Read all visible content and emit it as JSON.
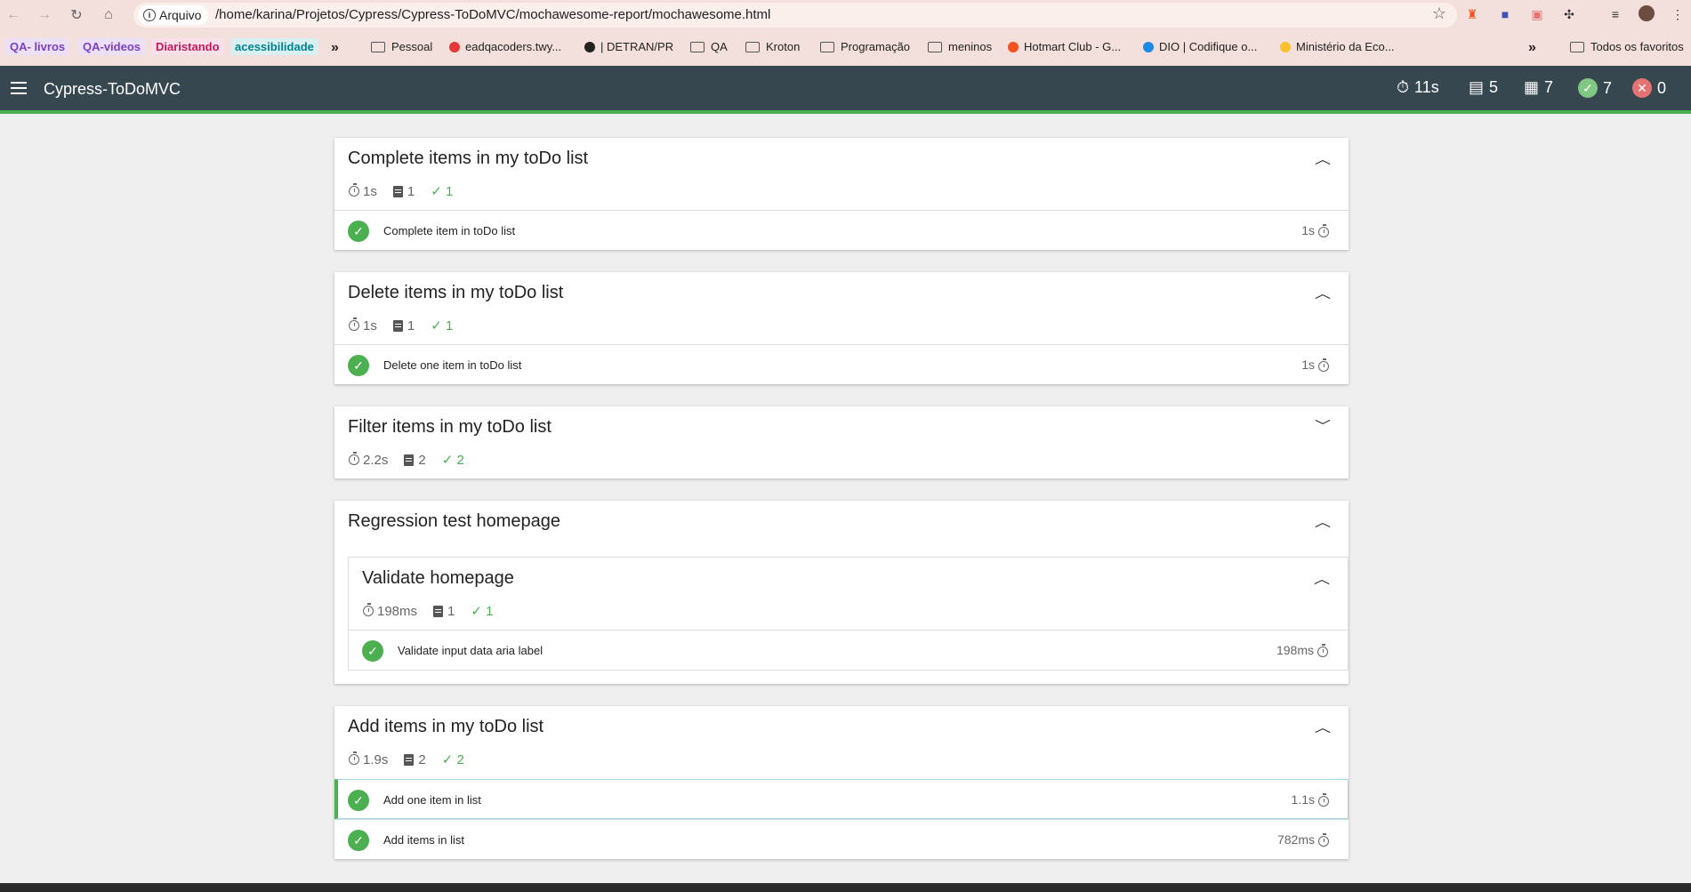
{
  "browser": {
    "chip_label": "Arquivo",
    "url": "/home/karina/Projetos/Cypress/Cypress-ToDoMVC/mochawesome-report/mochawesome.html",
    "bookmarks": [
      {
        "label": "QA- livros",
        "type": "tag",
        "color": "#7b3fc4",
        "bg": "#ece0f7"
      },
      {
        "label": "QA-videos",
        "type": "tag",
        "color": "#7b3fc4",
        "bg": "#ece0f7"
      },
      {
        "label": "Diaristando",
        "type": "tag",
        "color": "#c2185b",
        "bg": "#fbe0ea"
      },
      {
        "label": "acessibilidade",
        "type": "tag",
        "color": "#00838f",
        "bg": "#d8f0f2"
      },
      {
        "label": "»",
        "type": "more"
      },
      {
        "label": "Pessoal",
        "type": "folder"
      },
      {
        "label": "eadqacoders.twy...",
        "type": "site",
        "color": "#e53935"
      },
      {
        "label": "| DETRAN/PR",
        "type": "site",
        "color": "#222222"
      },
      {
        "label": "QA",
        "type": "folder"
      },
      {
        "label": "Kroton",
        "type": "folder"
      },
      {
        "label": "Programação",
        "type": "folder"
      },
      {
        "label": "meninos",
        "type": "folder"
      },
      {
        "label": "Hotmart Club - G...",
        "type": "site",
        "color": "#f4511e"
      },
      {
        "label": "DIO | Codifique o...",
        "type": "site",
        "color": "#1e88e5"
      },
      {
        "label": "Ministério da Eco...",
        "type": "site",
        "color": "#fbc02d"
      },
      {
        "label": "»",
        "type": "more"
      },
      {
        "label": "Todos os favoritos",
        "type": "folder"
      }
    ]
  },
  "app": {
    "title": "Cypress-ToDoMVC",
    "stats": {
      "duration": "11s",
      "suites": "5",
      "tests": "7",
      "passed": "7",
      "failed": "0"
    }
  },
  "suites": [
    {
      "title": "Complete items in my toDo list",
      "duration": "1s",
      "tests": "1",
      "passed": "1",
      "expanded": true,
      "rows": [
        {
          "name": "Complete item in toDo list",
          "duration": "1s"
        }
      ]
    },
    {
      "title": "Delete items in my toDo list",
      "duration": "1s",
      "tests": "1",
      "passed": "1",
      "expanded": true,
      "rows": [
        {
          "name": "Delete one item in toDo list",
          "duration": "1s"
        }
      ]
    },
    {
      "title": "Filter items in my toDo list",
      "duration": "2.2s",
      "tests": "2",
      "passed": "2",
      "expanded": false,
      "rows": []
    },
    {
      "title": "Regression test homepage",
      "expanded": true,
      "child": {
        "title": "Validate homepage",
        "duration": "198ms",
        "tests": "1",
        "passed": "1",
        "rows": [
          {
            "name": "Validate input data aria label",
            "duration": "198ms"
          }
        ]
      }
    },
    {
      "title": "Add items in my toDo list",
      "duration": "1.9s",
      "tests": "2",
      "passed": "2",
      "expanded": true,
      "rows": [
        {
          "name": "Add one item in list",
          "duration": "1.1s"
        },
        {
          "name": "Add items in list",
          "duration": "782ms"
        }
      ]
    }
  ],
  "icons": {
    "up": "chevron-up-icon",
    "down": "chevron-down-icon",
    "check": "check-icon",
    "stopwatch": "stopwatch-icon",
    "clipboard": "clipboard-icon"
  },
  "colors": {
    "header": "#37474f",
    "accent": "#4caf50",
    "failed": "#e57373"
  }
}
